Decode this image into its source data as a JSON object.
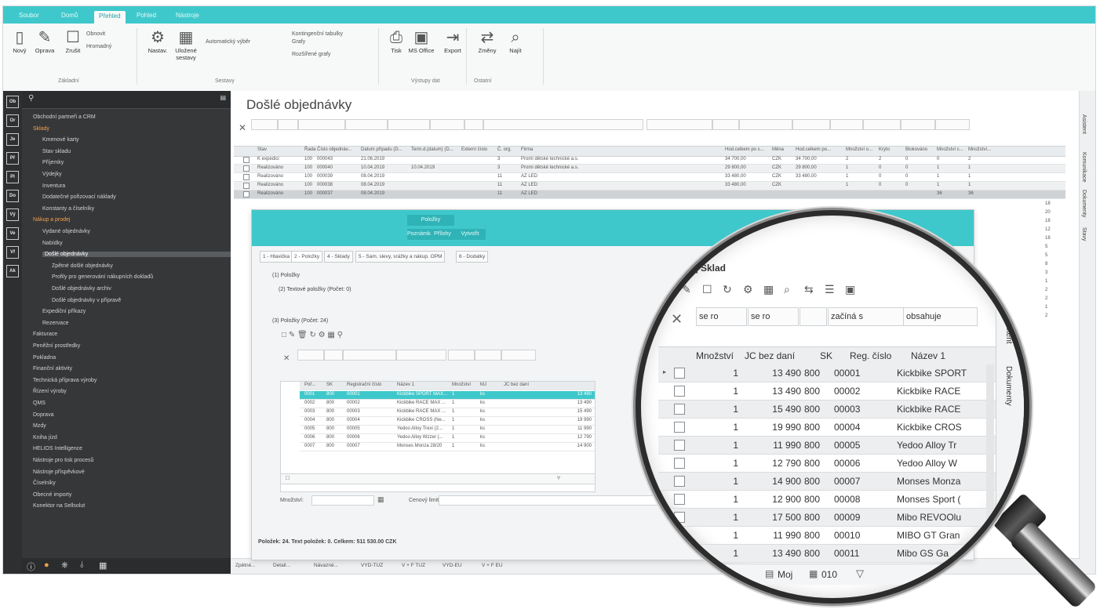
{
  "titlebar": {
    "tabs": [
      "Soubor",
      "Domů",
      "Přehled",
      "Pohled",
      "Nástroje"
    ],
    "active_index": 2
  },
  "ribbon": {
    "buttons": [
      {
        "label": "Nový",
        "icon": "file-icon"
      },
      {
        "label": "Oprava",
        "icon": "pencil-icon"
      },
      {
        "label": "Zrušit",
        "icon": "trash-icon"
      },
      {
        "label": "Nastav.",
        "icon": "gear-icon"
      },
      {
        "label": "Uložené sestavy",
        "icon": "grid-icon"
      },
      {
        "label": "Tisk",
        "icon": "printer-icon"
      },
      {
        "label": "MS Office",
        "icon": "office-icon"
      },
      {
        "label": "Export",
        "icon": "export-icon"
      },
      {
        "label": "Změny",
        "icon": "swap-icon"
      },
      {
        "label": "Najít",
        "icon": "search-icon"
      }
    ],
    "small": [
      "Obnovit",
      "Hromadný",
      "Automatický výběr",
      "Grafy",
      "Rozšířené grafy",
      "Kontingenční tabulky"
    ],
    "groups": [
      "Základní",
      "Sestavy",
      "Výstupy dat",
      "Ostatní"
    ]
  },
  "iconbar": {
    "items": [
      "Ob",
      "Or",
      "Je",
      "Př",
      "Pl",
      "Do",
      "Vý",
      "Ve",
      "Vf",
      "Ak"
    ]
  },
  "nav": {
    "items": [
      {
        "label": "Obchodní partneři a CRM",
        "style": "",
        "indent": 0
      },
      {
        "label": "Sklady",
        "style": "or",
        "indent": 0
      },
      {
        "label": "Kmenové karty",
        "style": "",
        "indent": 1
      },
      {
        "label": "Stav skladu",
        "style": "",
        "indent": 1
      },
      {
        "label": "Příjemky",
        "style": "",
        "indent": 1
      },
      {
        "label": "Výdejky",
        "style": "",
        "indent": 1
      },
      {
        "label": "Inventura",
        "style": "",
        "indent": 1
      },
      {
        "label": "Dodatečné pořizovací náklady",
        "style": "",
        "indent": 1
      },
      {
        "label": "Konstanty a číselníky",
        "style": "",
        "indent": 1
      },
      {
        "label": "Nákup a prodej",
        "style": "or",
        "indent": 0
      },
      {
        "label": "Vydané objednávky",
        "style": "",
        "indent": 1
      },
      {
        "label": "Nabídky",
        "style": "",
        "indent": 1
      },
      {
        "label": "Došlé objednávky",
        "style": "sel",
        "indent": 1
      },
      {
        "label": "Zpětné došlé objednávky",
        "style": "",
        "indent": 2
      },
      {
        "label": "Profily pro generování nákupních dokladů",
        "style": "",
        "indent": 2
      },
      {
        "label": "Došlé objednávky archiv",
        "style": "",
        "indent": 2
      },
      {
        "label": "Došlé objednávky v přípravě",
        "style": "",
        "indent": 2
      },
      {
        "label": "Expediční příkazy",
        "style": "",
        "indent": 1
      },
      {
        "label": "Rezervace",
        "style": "",
        "indent": 1
      },
      {
        "label": "Fakturace",
        "style": "",
        "indent": 0
      },
      {
        "label": "Peněžní prostředky",
        "style": "",
        "indent": 0
      },
      {
        "label": "Pokladna",
        "style": "",
        "indent": 0
      },
      {
        "label": "Finanční aktivity",
        "style": "",
        "indent": 0
      },
      {
        "label": "Technická příprava výroby",
        "style": "",
        "indent": 0
      },
      {
        "label": "Řízení výroby",
        "style": "",
        "indent": 0
      },
      {
        "label": "QMS",
        "style": "",
        "indent": 0
      },
      {
        "label": "Doprava",
        "style": "",
        "indent": 0
      },
      {
        "label": "Mzdy",
        "style": "",
        "indent": 0
      },
      {
        "label": "Kniha jízd",
        "style": "",
        "indent": 0
      },
      {
        "label": "HELIOS Intelligence",
        "style": "",
        "indent": 0
      },
      {
        "label": "Nástroje pro tisk procesů",
        "style": "",
        "indent": 0
      },
      {
        "label": "Nástroje příspěvkové",
        "style": "",
        "indent": 0
      },
      {
        "label": "Číselníky",
        "style": "",
        "indent": 0
      },
      {
        "label": "Obecné importy",
        "style": "",
        "indent": 0
      },
      {
        "label": "Konektor na Sellsolut",
        "style": "",
        "indent": 0
      }
    ]
  },
  "main": {
    "title": "Došlé objednávky",
    "columns": [
      "Stav",
      "Řada",
      "Číslo objednáv...",
      "Datum případu (D...",
      "Term.d.(datum) (D...",
      "Externí číslo",
      "Č. org.",
      "Firma",
      "Hod.celkem po s...",
      "Měna",
      "Hod.celkem po...",
      "Množství o...",
      "Kryto",
      "Blokováno",
      "Množství c...",
      "Množství..."
    ],
    "rows": [
      [
        "K expedici",
        "100",
        "000043",
        "21.06.2019",
        "",
        "",
        "3",
        "Promi dětské technické a.s.",
        "34 700,00",
        "CZK",
        "34 700,00",
        "2",
        "2",
        "0",
        "0",
        "2"
      ],
      [
        "Realizováno",
        "100",
        "000040",
        "10.04.2019",
        "10.04.2019",
        "",
        "3",
        "Promi dětské technické a.s.",
        "29 800,00",
        "CZK",
        "29 800,00",
        "1",
        "0",
        "0",
        "1",
        "1"
      ],
      [
        "Realizováno",
        "100",
        "000039",
        "08.04.2019",
        "",
        "",
        "11",
        "AZ LED",
        "33 480,00",
        "CZK",
        "33 480,00",
        "1",
        "0",
        "0",
        "1",
        "1"
      ],
      [
        "Realizováno",
        "100",
        "000038",
        "08.04.2019",
        "",
        "",
        "11",
        "AZ LED",
        "33 480,00",
        "CZK",
        "",
        "1",
        "0",
        "0",
        "1",
        "1"
      ],
      [
        "Realizováno",
        "100",
        "000037",
        "08.04.2019",
        "",
        "",
        "11",
        "AZ LED",
        "",
        "",
        "",
        "",
        "",
        "",
        "36",
        "36"
      ]
    ],
    "side_counts": [
      "18",
      "20",
      "18",
      "12",
      "18",
      "5",
      "5",
      "8",
      "3",
      "1",
      "2",
      "2",
      "1",
      "2"
    ]
  },
  "right_tabs": [
    "Asistent",
    "Komunikace",
    "Dokumenty",
    "Stavy"
  ],
  "dialog": {
    "tabs_top": [
      "Položky",
      "Poznámka",
      "Přílohy",
      "Vytvořit"
    ],
    "tabs": [
      "1 - Hlavička",
      "2 - Položky",
      "4 - Sklady",
      "5 - Sam. slevy, srážky a nákup. OPM",
      "6 - Dodatky"
    ],
    "sections": [
      "(1) Položky",
      "(2) Textové položky (Počet: 0)",
      "(3) Položky (Počet: 24)"
    ],
    "inner_columns": [
      "Poř...",
      "SK",
      "Registrační číslo",
      "Název 1",
      "Množství",
      "MJ",
      "JC bez daní"
    ],
    "inner_rows": [
      [
        "0001",
        "800",
        "00001",
        "Kickbike SPORT MAX...",
        "1",
        "ks",
        "13 490"
      ],
      [
        "0002",
        "800",
        "00002",
        "Kickbike RACE MAX ...",
        "1",
        "ks",
        "13 490"
      ],
      [
        "0003",
        "800",
        "00003",
        "Kickbike RACE MAX ...",
        "1",
        "ks",
        "15 490"
      ],
      [
        "0004",
        "800",
        "00004",
        "Kickbike CROSS (Ne...",
        "1",
        "ks",
        "19 990"
      ],
      [
        "0005",
        "800",
        "00005",
        "Yedoo Alloy Trexi (2...",
        "1",
        "ks",
        "11 990"
      ],
      [
        "0006",
        "800",
        "00006",
        "Yedoo Alloy Wzzer (...",
        "1",
        "ks",
        "12 790"
      ],
      [
        "0007",
        "800",
        "00007",
        "Monses Monza 28/20",
        "1",
        "ks",
        "14 900"
      ]
    ],
    "fields": {
      "quantity_label": "Množství:",
      "price_label": "Cenový limit:"
    },
    "status": "Položek: 24. Text položek: 0. Celkem: 511 530.00 CZK"
  },
  "bottombar": {
    "items": [
      "Zpětné...",
      "Detail...",
      "Návazné...",
      "VYD-TUZ",
      "V + F TUZ",
      "VYD-EU",
      "V + F EU"
    ]
  },
  "magnifier": {
    "title": "[4] Sklad",
    "filters": [
      "se ro",
      "se ro",
      "začíná s",
      "obsahuje"
    ],
    "columns": [
      "Množství",
      "JC bez daní",
      "SK",
      "Reg. číslo",
      "Název 1"
    ],
    "rows": [
      [
        "1",
        "13 490",
        "800",
        "00001",
        "Kickbike SPORT"
      ],
      [
        "1",
        "13 490",
        "800",
        "00002",
        "Kickbike RACE"
      ],
      [
        "1",
        "15 490",
        "800",
        "00003",
        "Kickbike RACE"
      ],
      [
        "1",
        "19 990",
        "800",
        "00004",
        "Kickbike CROS"
      ],
      [
        "1",
        "11 990",
        "800",
        "00005",
        "Yedoo Alloy Tr"
      ],
      [
        "1",
        "12 790",
        "800",
        "00006",
        "Yedoo Alloy W"
      ],
      [
        "1",
        "14 900",
        "800",
        "00007",
        "Monses Monza"
      ],
      [
        "1",
        "12 900",
        "800",
        "00008",
        "Monses Sport ("
      ],
      [
        "1",
        "17 500",
        "800",
        "00009",
        "Mibo REVOOlu"
      ],
      [
        "1",
        "11 990",
        "800",
        "00010",
        "MIBO GT Gran"
      ],
      [
        "1",
        "13 490",
        "800",
        "00011",
        "Mibo GS Ga"
      ]
    ],
    "side_tabs": [
      "Asistent",
      "Dokumenty"
    ],
    "footer": [
      "Moj",
      "010"
    ]
  }
}
